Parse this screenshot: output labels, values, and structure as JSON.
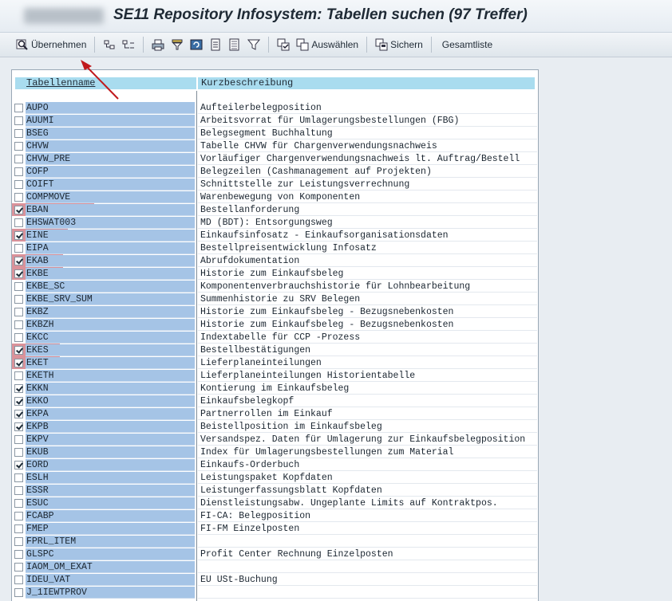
{
  "window": {
    "title": "SE11 Repository Infosystem: Tabellen suchen (97 Treffer)"
  },
  "toolbar": {
    "uebernehmen": "Übernehmen",
    "auswaehlen": "Auswählen",
    "sichern": "Sichern",
    "gesamtliste": "Gesamtliste"
  },
  "table": {
    "col_name": "Tabellenname",
    "col_desc": "Kurzbeschreibung",
    "rows": [
      {
        "name": "AUPO",
        "desc": "Aufteilerbelegposition",
        "checked": false,
        "highlight": false
      },
      {
        "name": "AUUMI",
        "desc": "Arbeitsvorrat für Umlagerungsbestellungen (FBG)",
        "checked": false,
        "highlight": false
      },
      {
        "name": "BSEG",
        "desc": "Belegsegment Buchhaltung",
        "checked": false,
        "highlight": false
      },
      {
        "name": "CHVW",
        "desc": "Tabelle CHVW für Chargenverwendungsnachweis",
        "checked": false,
        "highlight": false
      },
      {
        "name": "CHVW_PRE",
        "desc": "Vorläufiger Chargenverwendungsnachweis lt. Auftrag/Bestell",
        "checked": false,
        "highlight": false
      },
      {
        "name": "COFP",
        "desc": "Belegzeilen (Cashmanagement auf Projekten)",
        "checked": false,
        "highlight": false
      },
      {
        "name": "COIFT",
        "desc": "Schnittstelle zur Leistungsverrechnung",
        "checked": false,
        "highlight": false
      },
      {
        "name": "COMPMOVE",
        "desc": "Warenbewegung von Komponenten",
        "checked": false,
        "highlight": false
      },
      {
        "name": "EBAN",
        "desc": "Bestellanforderung",
        "checked": true,
        "highlight": true
      },
      {
        "name": "EHSWAT003",
        "desc": "MD (BDT): Entsorgungsweg",
        "checked": false,
        "highlight": false
      },
      {
        "name": "EINE",
        "desc": "Einkaufsinfosatz - Einkaufsorganisationsdaten",
        "checked": true,
        "highlight": true
      },
      {
        "name": "EIPA",
        "desc": "Bestellpreisentwicklung Infosatz",
        "checked": false,
        "highlight": false
      },
      {
        "name": "EKAB",
        "desc": "Abrufdokumentation",
        "checked": true,
        "highlight": true
      },
      {
        "name": "EKBE",
        "desc": "Historie zum Einkaufsbeleg",
        "checked": true,
        "highlight": true
      },
      {
        "name": "EKBE_SC",
        "desc": "Komponentenverbrauchshistorie für Lohnbearbeitung",
        "checked": false,
        "highlight": false
      },
      {
        "name": "EKBE_SRV_SUM",
        "desc": "Summenhistorie zu SRV Belegen",
        "checked": false,
        "highlight": false
      },
      {
        "name": "EKBZ",
        "desc": "Historie zum Einkaufsbeleg - Bezugsnebenkosten",
        "checked": false,
        "highlight": false
      },
      {
        "name": "EKBZH",
        "desc": "Historie zum Einkaufsbeleg - Bezugsnebenkosten",
        "checked": false,
        "highlight": false
      },
      {
        "name": "EKCC",
        "desc": "Indextabelle für CCP -Prozess",
        "checked": false,
        "highlight": false
      },
      {
        "name": "EKES",
        "desc": "Bestellbestätigungen",
        "checked": true,
        "highlight": true
      },
      {
        "name": "EKET",
        "desc": "Lieferplaneinteilungen",
        "checked": true,
        "highlight": true
      },
      {
        "name": "EKETH",
        "desc": "Lieferplaneinteilungen Historientabelle",
        "checked": false,
        "highlight": false
      },
      {
        "name": "EKKN",
        "desc": "Kontierung im Einkaufsbeleg",
        "checked": true,
        "highlight": false
      },
      {
        "name": "EKKO",
        "desc": "Einkaufsbelegkopf",
        "checked": true,
        "highlight": false
      },
      {
        "name": "EKPA",
        "desc": "Partnerrollen im Einkauf",
        "checked": true,
        "highlight": false
      },
      {
        "name": "EKPB",
        "desc": "Beistellposition im Einkaufsbeleg",
        "checked": true,
        "highlight": false
      },
      {
        "name": "EKPV",
        "desc": "Versandspez. Daten für Umlagerung zur Einkaufsbelegposition",
        "checked": false,
        "highlight": false
      },
      {
        "name": "EKUB",
        "desc": "Index für Umlagerungsbestellungen zum Material",
        "checked": false,
        "highlight": false
      },
      {
        "name": "EORD",
        "desc": "Einkaufs-Orderbuch",
        "checked": true,
        "highlight": false
      },
      {
        "name": "ESLH",
        "desc": "Leistungspaket Kopfdaten",
        "checked": false,
        "highlight": false
      },
      {
        "name": "ESSR",
        "desc": "Leistungerfassungsblatt Kopfdaten",
        "checked": false,
        "highlight": false
      },
      {
        "name": "ESUC",
        "desc": "Dienstleistungsabw. Ungeplante Limits auf Kontraktpos.",
        "checked": false,
        "highlight": false
      },
      {
        "name": "FCABP",
        "desc": "FI-CA: Belegposition",
        "checked": false,
        "highlight": false
      },
      {
        "name": "FMEP",
        "desc": "FI-FM Einzelposten",
        "checked": false,
        "highlight": false
      },
      {
        "name": "FPRL_ITEM",
        "desc": "",
        "checked": false,
        "highlight": false
      },
      {
        "name": "GLSPC",
        "desc": "Profit Center Rechnung  Einzelposten",
        "checked": false,
        "highlight": false
      },
      {
        "name": "IAOM_OM_EXAT",
        "desc": "",
        "checked": false,
        "highlight": false
      },
      {
        "name": "IDEU_VAT",
        "desc": "EU USt-Buchung",
        "checked": false,
        "highlight": false
      },
      {
        "name": "J_1IEWTPROV",
        "desc": "",
        "checked": false,
        "highlight": false
      }
    ]
  },
  "colors": {
    "name_bg": "#a5c4e6",
    "header_bg": "#a9dcef",
    "highlight": "#cd6e78",
    "arrow": "#c0181c"
  }
}
